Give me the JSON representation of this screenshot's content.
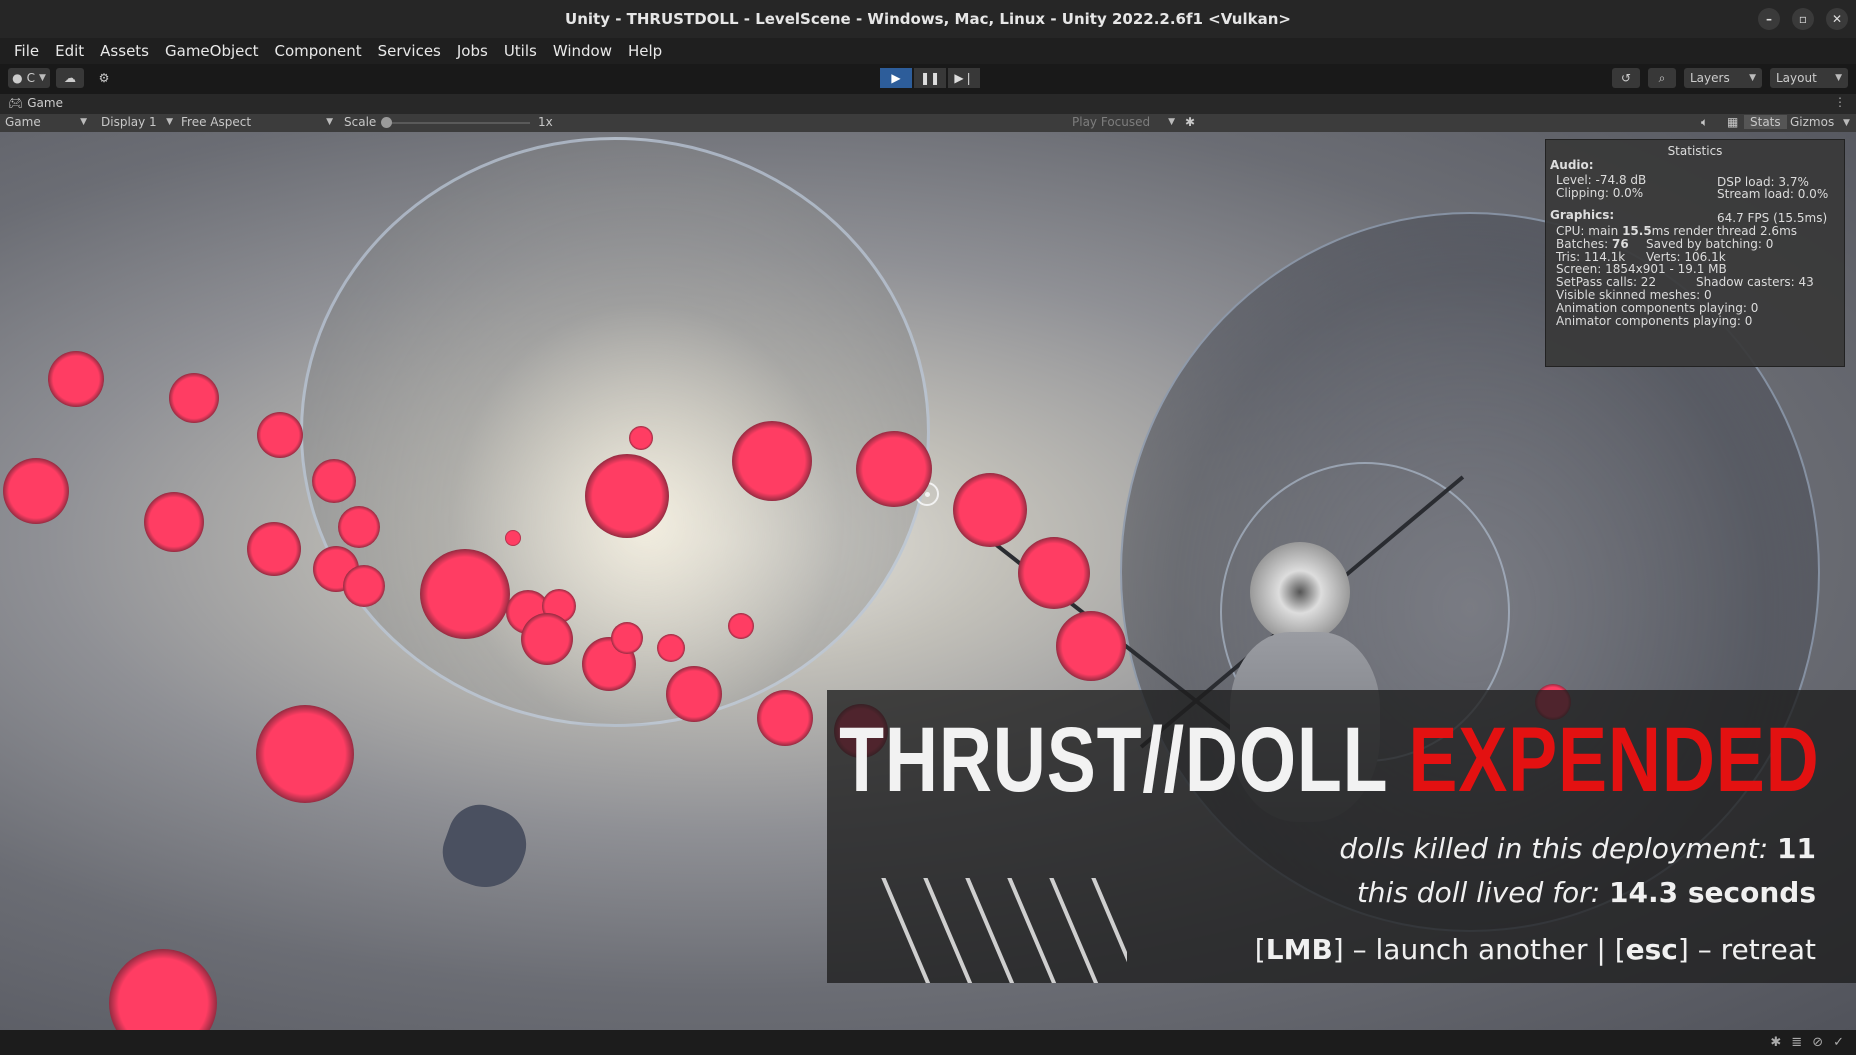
{
  "window": {
    "title": "Unity - THRUSTDOLL - LevelScene - Windows, Mac, Linux - Unity 2022.2.6f1 <Vulkan>",
    "controls": [
      "–",
      "▫",
      "✕"
    ]
  },
  "menu": [
    "File",
    "Edit",
    "Assets",
    "GameObject",
    "Component",
    "Services",
    "Jobs",
    "Utils",
    "Window",
    "Help"
  ],
  "toolbar": {
    "account_label": "C",
    "layers_label": "Layers",
    "layout_label": "Layout"
  },
  "tab": {
    "label": "Game"
  },
  "game_controls": {
    "view_mode": "Game",
    "display": "Display 1",
    "aspect": "Free Aspect",
    "scale_label": "Scale",
    "scale_value": "1x",
    "play_focused": "Play Focused",
    "stats_label": "Stats",
    "gizmos_label": "Gizmos"
  },
  "stats": {
    "title": "Statistics",
    "audio_header": "Audio:",
    "level": "Level: -74.8 dB",
    "clipping": "Clipping: 0.0%",
    "dsp_load": "DSP load: 3.7%",
    "stream_load": "Stream load: 0.0%",
    "graphics_header": "Graphics:",
    "fps": "64.7 FPS (15.5ms)",
    "cpu_prefix": "CPU: main ",
    "cpu_main": "15.5",
    "cpu_suffix": "ms  render thread 2.6ms",
    "batches_prefix": "Batches: ",
    "batches": "76",
    "saved_batching": "Saved by batching: 0",
    "tris": "Tris: 114.1k",
    "verts": "Verts: 106.1k",
    "screen": "Screen: 1854x901 - 19.1 MB",
    "setpass": "SetPass calls: 22",
    "shadow_casters": "Shadow casters: 43",
    "skinned": "Visible skinned meshes: 0",
    "animation": "Animation components playing: 0",
    "animator": "Animator components playing: 0"
  },
  "overlay": {
    "title_white": "THRUST//DOLL ",
    "title_red": "EXPENDED",
    "killed_label": "dolls killed in this deployment: ",
    "killed_value": "11",
    "lived_label": "this doll lived for: ",
    "lived_value": "14.3 seconds",
    "hint_open1": "[",
    "hint_key1": "LMB",
    "hint_text1": "] – launch another | [",
    "hint_key2": "esc",
    "hint_text2": "] – retreat",
    "title_red_color": "#e31111"
  },
  "colors": {
    "orb": "#ff3d63",
    "orb_ring": "#8a2a3e",
    "play_active": "#2d5d9a"
  }
}
